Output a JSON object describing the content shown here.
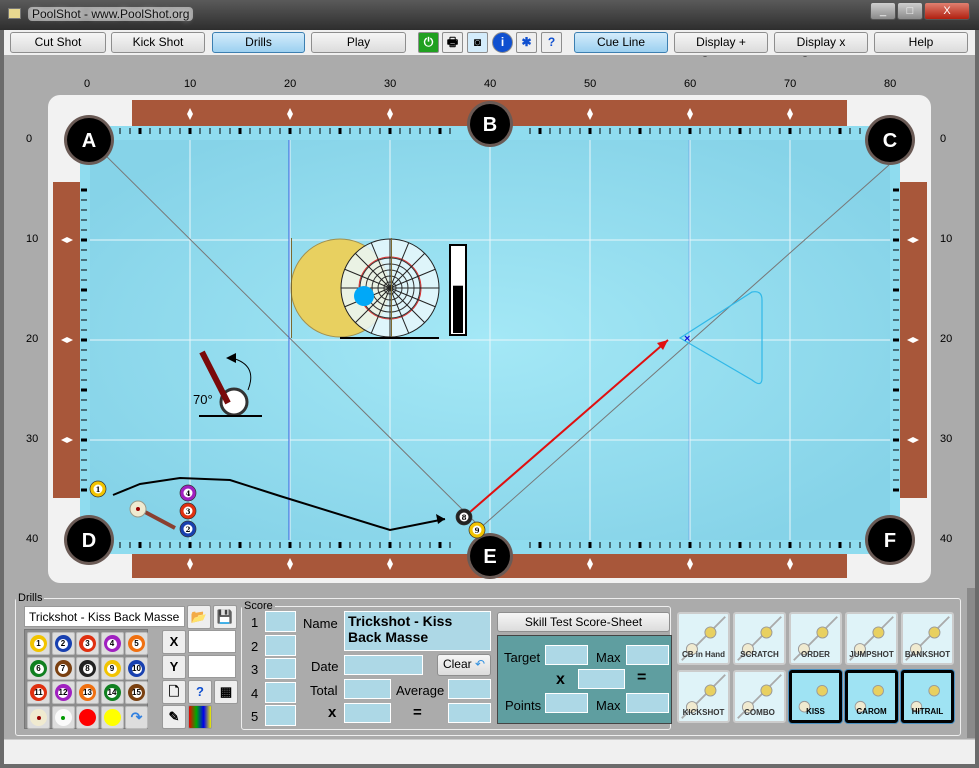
{
  "window": {
    "title": "PoolShot - www.PoolShot.org",
    "controls": [
      "_",
      "□",
      "X"
    ]
  },
  "toolbar": {
    "modes": [
      {
        "label": "Cut Shot",
        "active": false
      },
      {
        "label": "Kick Shot",
        "active": false
      },
      {
        "label": "Drills",
        "active": true
      },
      {
        "label": "Play",
        "active": false
      }
    ],
    "icons": [
      "power-icon",
      "print-icon",
      "camera-icon",
      "info-icon",
      "settings-icon",
      "help-doc-icon"
    ],
    "cue_line": "Cue Line",
    "display_plus": "Display + System",
    "display_x": "Display x System",
    "help": "Help"
  },
  "table": {
    "x_ticks": [
      "0",
      "10",
      "20",
      "30",
      "40",
      "50",
      "60",
      "70",
      "80"
    ],
    "y_ticks": [
      "0",
      "10",
      "20",
      "30",
      "40"
    ],
    "pockets": [
      {
        "label": "A",
        "x": 0,
        "y": 0
      },
      {
        "label": "B",
        "x": 40,
        "y": -1.6
      },
      {
        "label": "C",
        "x": 80,
        "y": 0
      },
      {
        "label": "D",
        "x": 0,
        "y": 40
      },
      {
        "label": "E",
        "x": 40,
        "y": 41.6
      },
      {
        "label": "F",
        "x": 80,
        "y": 40
      }
    ],
    "balls": [
      {
        "n": "1",
        "x": 0.8,
        "y": 34.9,
        "color": "#f2c400"
      },
      {
        "n": "4",
        "x": 9.8,
        "y": 35.3,
        "color": "#a020c0"
      },
      {
        "n": "3",
        "x": 9.8,
        "y": 37.1,
        "color": "#e03010"
      },
      {
        "n": "2",
        "x": 9.8,
        "y": 38.9,
        "color": "#1840b0"
      },
      {
        "n": "8",
        "x": 37.4,
        "y": 37.7,
        "color": "#222222"
      },
      {
        "n": "9",
        "x": 38.7,
        "y": 39.0,
        "color": "#f2c400"
      }
    ],
    "cue_ball": {
      "x": 4.8,
      "y": 36.9
    },
    "target": {
      "x": 59.9,
      "y": 19.8
    },
    "cue_elevation": "70°",
    "power_level": 0.55,
    "cloth_color": "#8fdcef",
    "rail_color": "#a8573a"
  },
  "drills": {
    "legend": "Drills",
    "name": "Trickshot - Kiss Back Masse",
    "balls": [
      [
        "1",
        "#f2c400"
      ],
      [
        "2",
        "#1840b0"
      ],
      [
        "3",
        "#e03010"
      ],
      [
        "4",
        "#a020c0"
      ],
      [
        "5",
        "#f07010"
      ],
      [
        "6",
        "#108020"
      ],
      [
        "7",
        "#7a4010"
      ],
      [
        "8",
        "#222222"
      ],
      [
        "9",
        "#f2c400"
      ],
      [
        "10",
        "#1840b0"
      ],
      [
        "11",
        "#e03010"
      ],
      [
        "12",
        "#a020c0"
      ],
      [
        "13",
        "#f07010"
      ],
      [
        "14",
        "#108020"
      ],
      [
        "15",
        "#7a4010"
      ]
    ],
    "x_label": "X",
    "y_label": "Y",
    "x_value": "",
    "y_value": ""
  },
  "score": {
    "legend": "Score",
    "rows": [
      "1",
      "2",
      "3",
      "4",
      "5"
    ],
    "name_label": "Name",
    "name_value": "Trickshot - Kiss Back Masse",
    "date_label": "Date",
    "clear": "Clear",
    "total_label": "Total",
    "average_label": "Average",
    "x_sign": "x",
    "eq_sign": "="
  },
  "skill": {
    "button": "Skill Test Score-Sheet",
    "target": "Target",
    "max": "Max",
    "points": "Points",
    "x_sign": "x",
    "eq_sign": "="
  },
  "categories": [
    {
      "label": "CB in Hand",
      "active": false
    },
    {
      "label": "SCRATCH",
      "active": false
    },
    {
      "label": "ORDER",
      "active": false
    },
    {
      "label": "JUMPSHOT",
      "active": false
    },
    {
      "label": "BANKSHOT",
      "active": false
    },
    {
      "label": "KICKSHOT",
      "active": false
    },
    {
      "label": "COMBO",
      "active": false
    },
    {
      "label": "KISS",
      "active": true
    },
    {
      "label": "CAROM",
      "active": true
    },
    {
      "label": "HITRAIL",
      "active": true
    }
  ]
}
